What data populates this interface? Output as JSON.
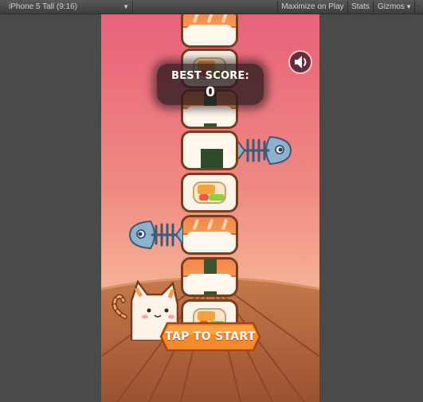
{
  "toolbar": {
    "aspect_label": "iPhone 5 Tall (9:16)",
    "maximize_label": "Maximize on Play",
    "stats_label": "Stats",
    "gizmos_label": "Gizmos"
  },
  "game": {
    "best_score_label": "BEST SCORE:",
    "best_score_value": "0",
    "start_label": "TAP TO START",
    "sound_icon": "speaker-icon",
    "colors": {
      "sky_top": "#e8627a",
      "sky_bottom": "#f9c6a4",
      "table": "#b0623a",
      "button_orange": "#f6892a"
    }
  }
}
